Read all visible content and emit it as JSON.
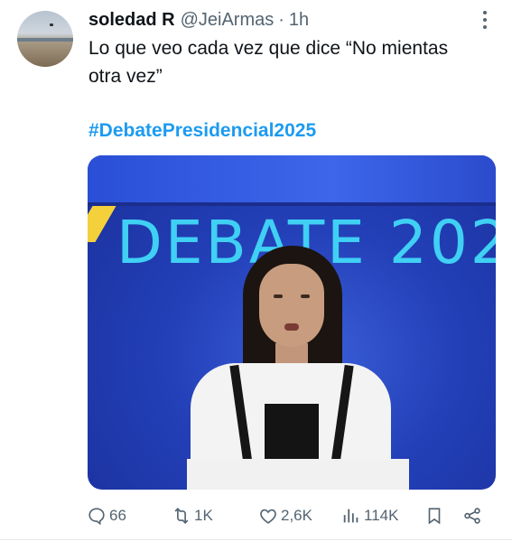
{
  "tweet": {
    "display_name": "soledad R",
    "handle": "@JeiArmas",
    "separator": "·",
    "time": "1h",
    "text": "Lo que veo cada vez que dice “No mientas otra vez”",
    "hashtag": "#DebatePresidencial2025"
  },
  "media": {
    "overlay_text": "DEBATE 202",
    "background_color": "#2340b8",
    "title_color": "#3fd0f4"
  },
  "actions": {
    "replies": {
      "icon": "reply-icon",
      "count": "66"
    },
    "reposts": {
      "icon": "repost-icon",
      "count": "1K"
    },
    "likes": {
      "icon": "heart-icon",
      "count": "2,6K"
    },
    "views": {
      "icon": "views-icon",
      "count": "114K"
    },
    "bookmark": {
      "icon": "bookmark-icon"
    },
    "share": {
      "icon": "share-icon"
    }
  },
  "colors": {
    "text": "#0f1419",
    "secondary": "#536471",
    "link": "#1d9bf0"
  }
}
